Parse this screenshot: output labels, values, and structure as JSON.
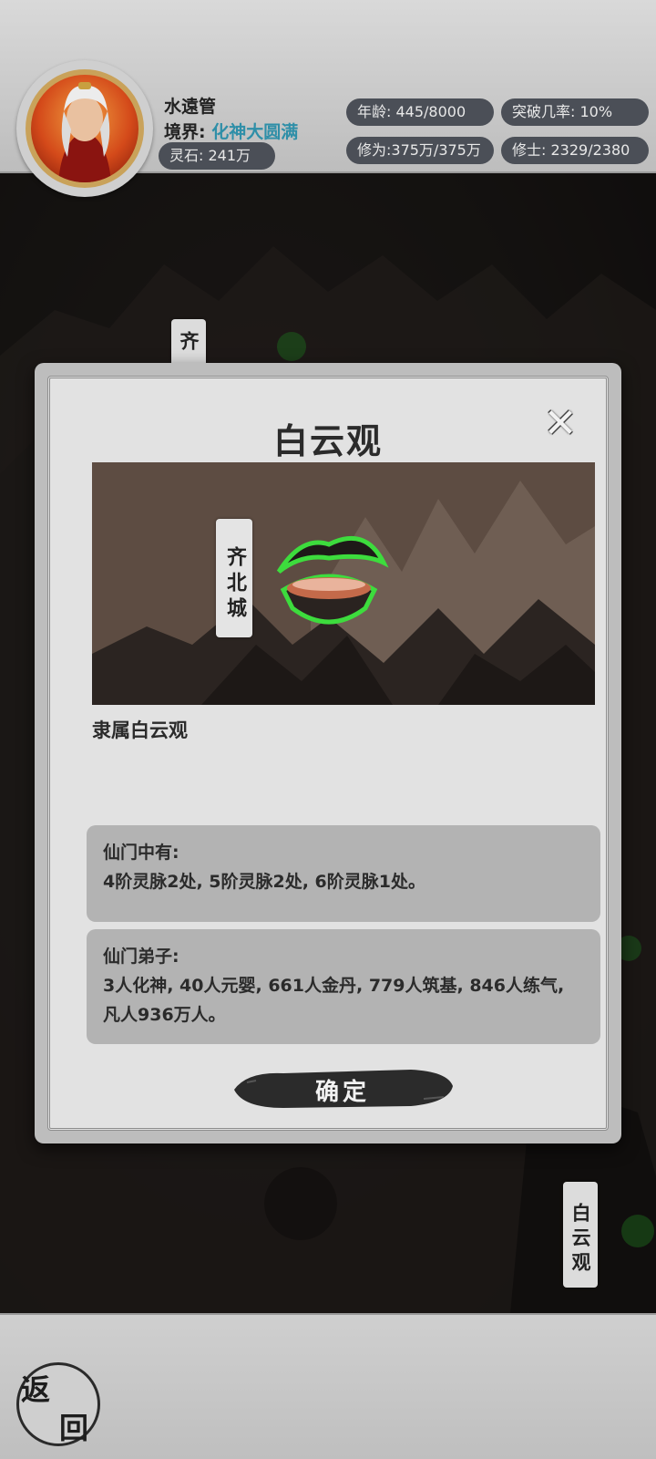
{
  "header": {
    "player_name": "水遠管",
    "realm_label": "境界:",
    "realm_value": "化神大圆满",
    "spirit_stone": "灵石: 241万",
    "age": "年龄: 445/8000",
    "breakthrough": "突破几率: 10%",
    "cultivation": "修为:375万/375万",
    "cultivators": "修士: 2329/2380"
  },
  "map": {
    "tag_left": "齐",
    "tag_bottom_right": "白云观"
  },
  "dialog": {
    "title": "白云观",
    "scene_city_label": "齐北城",
    "subtitle": "隶属白云观",
    "box1_heading": "仙门中有:",
    "box1_body": "4阶灵脉2处, 5阶灵脉2处, 6阶灵脉1处。",
    "box2_heading": "仙门弟子:",
    "box2_body": "3人化神, 40人元婴, 661人金丹, 779人筑基, 846人练气, 凡人936万人。",
    "confirm_label": "确定",
    "close_symbol": "✕"
  },
  "footer": {
    "back_top": "返",
    "back_bottom": "回"
  },
  "colors": {
    "pill_bg": "#4b4f57",
    "realm_accent": "#2f8fa8",
    "glow_green": "#3ddc3d"
  }
}
